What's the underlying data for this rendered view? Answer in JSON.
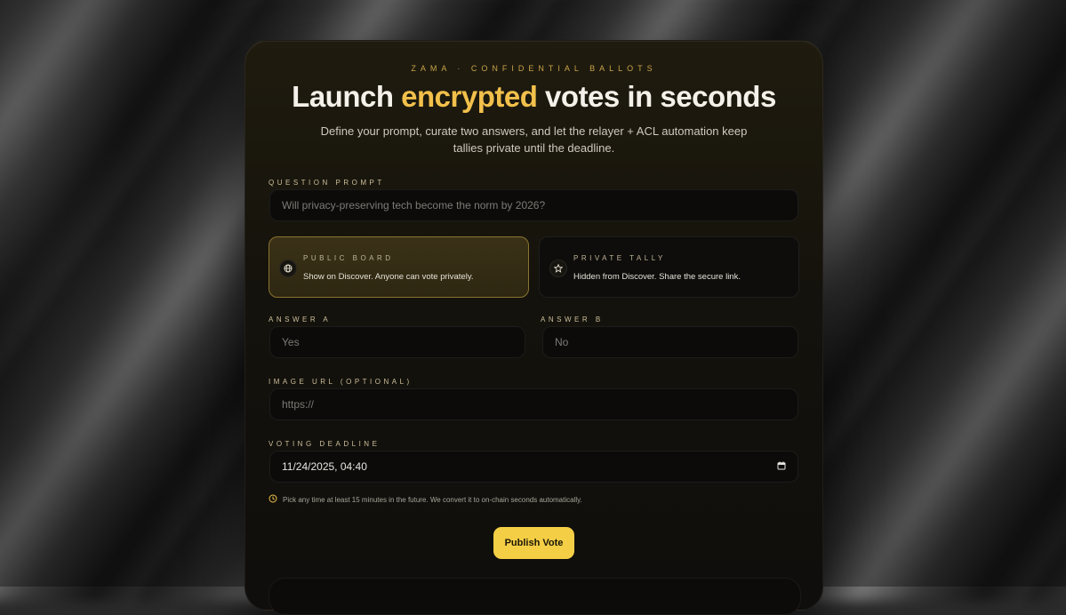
{
  "hero": {
    "eyebrow": "ZAMA · CONFIDENTIAL BALLOTS",
    "title_pre": "Launch ",
    "title_accent": "encrypted",
    "title_post": " votes in seconds",
    "subtitle": "Define your prompt, curate two answers, and let the relayer + ACL automation keep tallies private until the deadline."
  },
  "question": {
    "label": "QUESTION PROMPT",
    "placeholder": "Will privacy-preserving tech become the norm by 2026?"
  },
  "visibility": {
    "public": {
      "title": "PUBLIC BOARD",
      "desc": "Show on Discover. Anyone can vote privately.",
      "icon": "globe-icon",
      "selected": true
    },
    "private": {
      "title": "PRIVATE TALLY",
      "desc": "Hidden from Discover. Share the secure link.",
      "icon": "star-icon",
      "selected": false
    }
  },
  "answers": {
    "a_label": "ANSWER A",
    "a_placeholder": "Yes",
    "b_label": "ANSWER B",
    "b_placeholder": "No"
  },
  "image": {
    "label": "IMAGE URL (OPTIONAL)",
    "placeholder": "https://"
  },
  "deadline": {
    "label": "VOTING DEADLINE",
    "value": "11/24/2025, 04:40",
    "hint": "Pick any time at least 15 minutes in the future. We convert it to on-chain seconds automatically."
  },
  "actions": {
    "publish_label": "Publish Vote"
  },
  "colors": {
    "accent": "#f2c04b",
    "button": "#f4ce45"
  }
}
